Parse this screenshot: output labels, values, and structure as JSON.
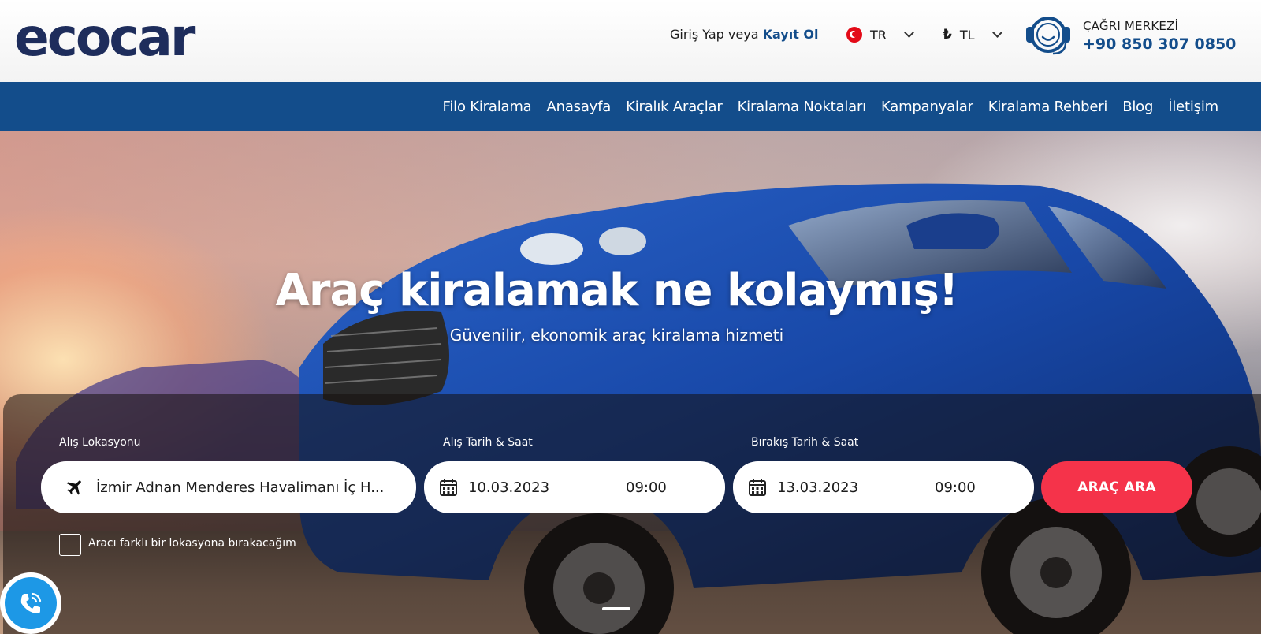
{
  "header": {
    "logo_text": "ecocar",
    "login_prefix": "Giriş Yap veya",
    "login_link": "Kayıt Ol",
    "language": "TR",
    "currency_symbol": "₺",
    "currency": "TL",
    "call_center_label": "ÇAĞRI MERKEZİ",
    "call_center_phone": "+90 850 307 0850"
  },
  "nav": {
    "items": [
      "Filo Kiralama",
      "Anasayfa",
      "Kiralık Araçlar",
      "Kiralama Noktaları",
      "Kampanyalar",
      "Kiralama Rehberi",
      "Blog",
      "İletişim"
    ]
  },
  "hero": {
    "title": "Araç kiralamak ne kolaymış!",
    "subtitle": "Güvenilir, ekonomik araç kiralama hizmeti"
  },
  "search": {
    "pickup_label": "Alış Lokasyonu",
    "pickup_value": "İzmir Adnan Menderes Havalimanı İç H...",
    "pickup_date_label": "Alış Tarih & Saat",
    "pickup_date": "10.03.2023",
    "pickup_time": "09:00",
    "dropoff_date_label": "Bırakış Tarih & Saat",
    "dropoff_date": "13.03.2023",
    "dropoff_time": "09:00",
    "search_button": "ARAÇ ARA",
    "different_location_label": "Aracı farklı bir lokasyona bırakacağım",
    "different_location_checked": false
  },
  "colors": {
    "brand_blue": "#134d8b",
    "accent_red": "#f5334a",
    "call_button_blue": "#1d98e6"
  }
}
